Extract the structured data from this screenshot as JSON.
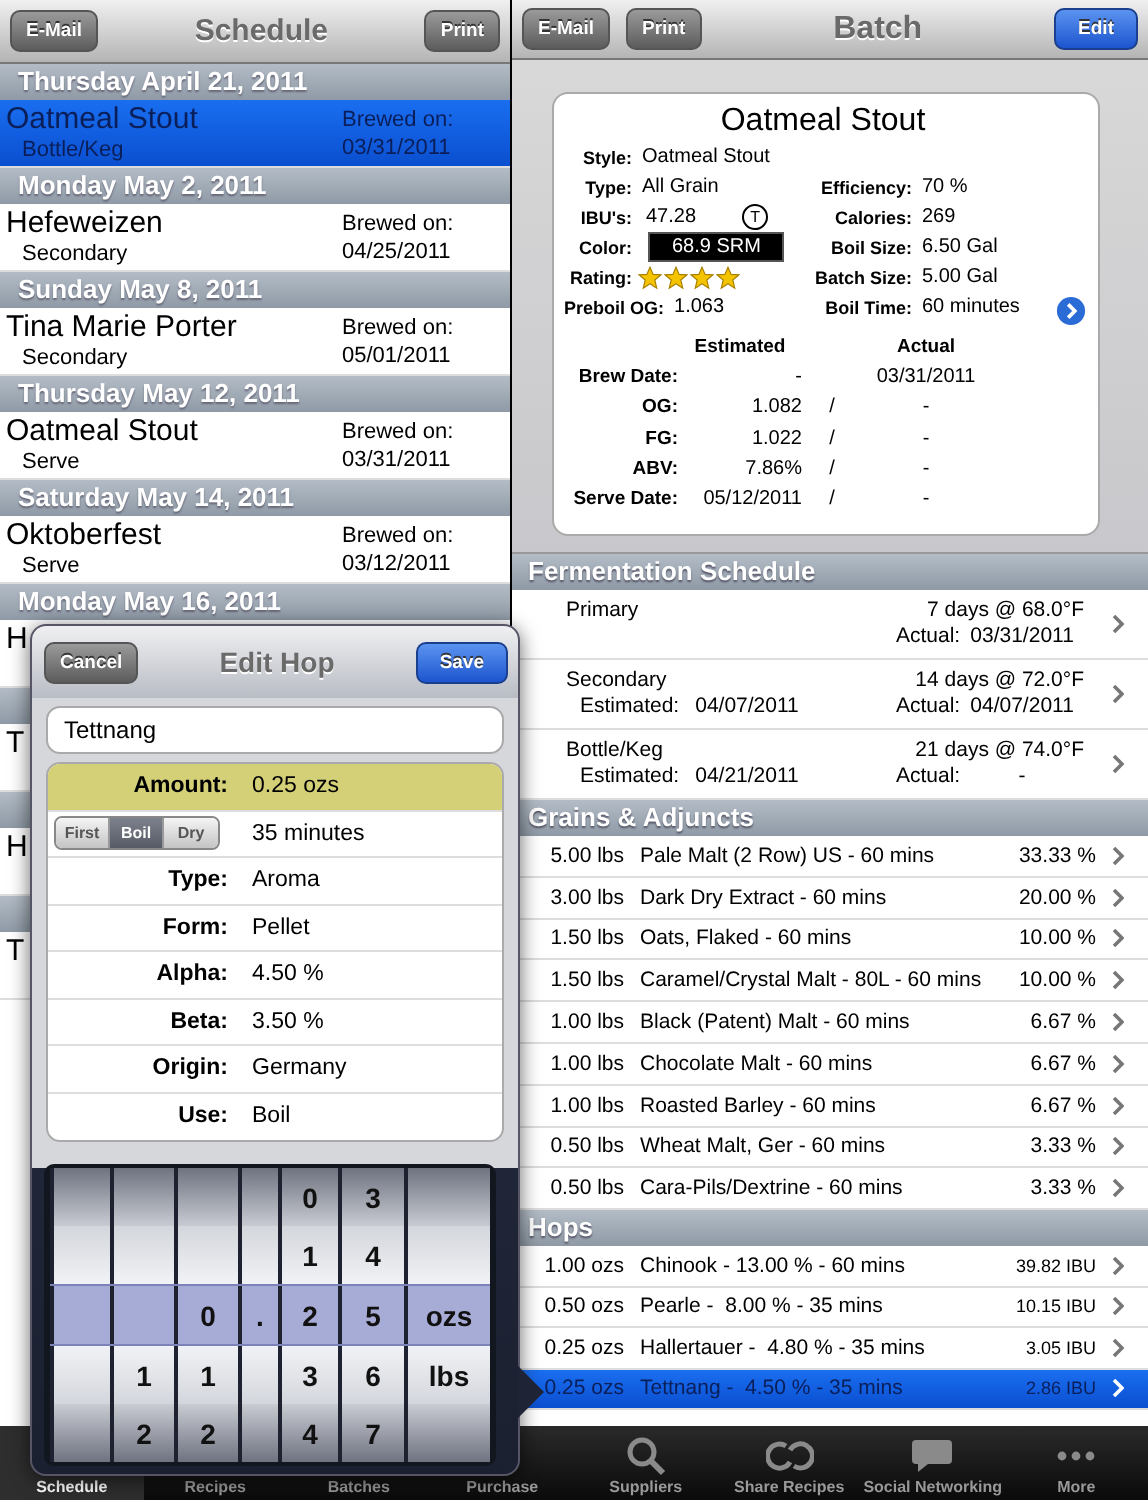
{
  "schedule": {
    "toolbar": {
      "email": "E-Mail",
      "title": "Schedule",
      "print": "Print"
    },
    "entries": [
      {
        "date": "Thursday April 21, 2011",
        "title": "Oatmeal Stout",
        "stage": "Bottle/Keg",
        "brewed_label": "Brewed on:",
        "brewed_date": "03/31/2011",
        "selected": true
      },
      {
        "date": "Monday May 2, 2011",
        "title": "Hefeweizen",
        "stage": "Secondary",
        "brewed_label": "Brewed on:",
        "brewed_date": "04/25/2011",
        "selected": false
      },
      {
        "date": "Sunday May 8, 2011",
        "title": "Tina Marie Porter",
        "stage": "Secondary",
        "brewed_label": "Brewed on:",
        "brewed_date": "05/01/2011",
        "selected": false
      },
      {
        "date": "Thursday May 12, 2011",
        "title": "Oatmeal Stout",
        "stage": "Serve",
        "brewed_label": "Brewed on:",
        "brewed_date": "03/31/2011",
        "selected": false
      },
      {
        "date": "Saturday May 14, 2011",
        "title": "Oktoberfest",
        "stage": "Serve",
        "brewed_label": "Brewed on:",
        "brewed_date": "03/12/2011",
        "selected": false
      },
      {
        "date": "Monday May 16, 2011",
        "title": "H",
        "selected": false
      },
      {
        "title": "T",
        "selected": false
      },
      {
        "title": "H",
        "selected": false
      },
      {
        "title": "T",
        "selected": false
      }
    ]
  },
  "batch": {
    "toolbar": {
      "email": "E-Mail",
      "print": "Print",
      "title": "Batch",
      "edit": "Edit"
    },
    "card": {
      "title": "Oatmeal Stout",
      "rows": [
        {
          "left": {
            "kind": "text",
            "label": "Style:",
            "value": "Oatmeal Stout"
          }
        },
        {
          "left": {
            "kind": "text",
            "label": "Type:",
            "value": "All Grain"
          },
          "right": {
            "label": "Efficiency:",
            "value": "70 %"
          }
        },
        {
          "left": {
            "kind": "ibu",
            "label": "IBU's:",
            "value": "47.28",
            "badge": "T"
          },
          "right": {
            "label": "Calories:",
            "value": "269"
          }
        },
        {
          "left": {
            "kind": "color",
            "label": "Color:",
            "value": "68.9 SRM"
          },
          "right": {
            "label": "Boil Size:",
            "value": "6.50 Gal"
          }
        },
        {
          "left": {
            "kind": "stars",
            "label": "Rating:",
            "stars": 4
          },
          "right": {
            "label": "Batch Size:",
            "value": "5.00 Gal"
          }
        },
        {
          "left": {
            "kind": "text",
            "label": "Preboil OG:",
            "value": "1.063"
          },
          "right": {
            "label": "Boil Time:",
            "value": "60 minutes"
          }
        }
      ],
      "columns": {
        "estimated": "Estimated",
        "actual": "Actual"
      },
      "measures": [
        {
          "label": "Brew Date:",
          "estimated": "-",
          "actual": "03/31/2011"
        },
        {
          "label": "OG:",
          "estimated": "1.082",
          "separator": "/",
          "actual": "-"
        },
        {
          "label": "FG:",
          "estimated": "1.022",
          "separator": "/",
          "actual": "-"
        },
        {
          "label": "ABV:",
          "estimated": "7.86%",
          "separator": "/",
          "actual": "-"
        },
        {
          "label": "Serve Date:",
          "estimated": "05/12/2011",
          "separator": "/",
          "actual": "-"
        }
      ]
    },
    "fermentation": {
      "title": "Fermentation Schedule",
      "rows": [
        {
          "name": "Primary",
          "duration": "7 days @ 68.0°F",
          "actual_label": "Actual:",
          "actual": "03/31/2011"
        },
        {
          "name": "Secondary",
          "estimated_label": "Estimated:",
          "estimated": "04/07/2011",
          "duration": "14 days @ 72.0°F",
          "actual_label": "Actual:",
          "actual": "04/07/2011"
        },
        {
          "name": "Bottle/Keg",
          "estimated_label": "Estimated:",
          "estimated": "04/21/2011",
          "duration": "21 days @ 74.0°F",
          "actual_label": "Actual:",
          "actual": "-"
        }
      ]
    },
    "grains": {
      "title": "Grains & Adjuncts",
      "rows": [
        {
          "amount": "5.00 lbs",
          "name": "Pale Malt (2 Row) US - 60 mins",
          "share": "33.33 %"
        },
        {
          "amount": "3.00 lbs",
          "name": "Dark Dry Extract - 60 mins",
          "share": "20.00 %"
        },
        {
          "amount": "1.50 lbs",
          "name": "Oats, Flaked - 60 mins",
          "share": "10.00 %"
        },
        {
          "amount": "1.50 lbs",
          "name": "Caramel/Crystal Malt - 80L - 60 mins",
          "share": "10.00 %"
        },
        {
          "amount": "1.00 lbs",
          "name": "Black (Patent) Malt - 60 mins",
          "share": "6.67 %"
        },
        {
          "amount": "1.00 lbs",
          "name": "Chocolate Malt - 60 mins",
          "share": "6.67 %"
        },
        {
          "amount": "1.00 lbs",
          "name": "Roasted Barley - 60 mins",
          "share": "6.67 %"
        },
        {
          "amount": "0.50 lbs",
          "name": "Wheat Malt, Ger - 60 mins",
          "share": "3.33 %"
        },
        {
          "amount": "0.50 lbs",
          "name": "Cara-Pils/Dextrine - 60 mins",
          "share": "3.33 %"
        }
      ]
    },
    "hops": {
      "title": "Hops",
      "rows": [
        {
          "amount": "1.00 ozs",
          "name": "Chinook - 13.00 % - 60 mins",
          "ibu": "39.82 IBU",
          "selected": false
        },
        {
          "amount": "0.50 ozs",
          "name": "Pearle -  8.00 % - 35 mins",
          "ibu": "10.15 IBU",
          "selected": false
        },
        {
          "amount": "0.25 ozs",
          "name": "Hallertauer -  4.80 % - 35 mins",
          "ibu": "3.05 IBU",
          "selected": false
        },
        {
          "amount": "0.25 ozs",
          "name": "Tettnang -  4.50 % - 35 mins",
          "ibu": "2.86 IBU",
          "selected": true
        }
      ]
    }
  },
  "edit_hop": {
    "cancel": "Cancel",
    "title": "Edit Hop",
    "save": "Save",
    "name": "Tettnang",
    "rows": [
      {
        "kind": "field",
        "label": "Amount:",
        "value": "0.25 ozs",
        "selected": true
      },
      {
        "kind": "segmented",
        "segments": [
          {
            "label": "First",
            "selected": false
          },
          {
            "label": "Boil",
            "selected": true
          },
          {
            "label": "Dry",
            "selected": false
          }
        ],
        "value": "35 minutes",
        "selected": false
      },
      {
        "kind": "field",
        "label": "Type:",
        "value": "Aroma",
        "selected": false
      },
      {
        "kind": "field",
        "label": "Form:",
        "value": "Pellet",
        "selected": false
      },
      {
        "kind": "field",
        "label": "Alpha:",
        "value": "4.50 %",
        "selected": false
      },
      {
        "kind": "field",
        "label": "Beta:",
        "value": "3.50 %",
        "selected": false
      },
      {
        "kind": "field",
        "label": "Origin:",
        "value": "Germany",
        "selected": false
      },
      {
        "kind": "field",
        "label": "Use:",
        "value": "Boil",
        "selected": false
      }
    ],
    "picker": [
      {
        "cells": [
          null,
          null,
          null,
          null,
          "0",
          "3",
          null
        ],
        "selected": false
      },
      {
        "cells": [
          null,
          null,
          null,
          null,
          "1",
          "4",
          null
        ],
        "selected": false
      },
      {
        "cells": [
          null,
          null,
          "0",
          ".",
          "2",
          "5",
          "ozs"
        ],
        "selected": true
      },
      {
        "cells": [
          null,
          "1",
          "1",
          null,
          "3",
          "6",
          "lbs"
        ],
        "selected": false
      },
      {
        "cells": [
          null,
          "2",
          "2",
          null,
          "4",
          "7",
          null
        ],
        "selected": false
      }
    ]
  },
  "tab_bar": [
    {
      "label": "Schedule",
      "selected": true
    },
    {
      "label": "Recipes",
      "selected": false
    },
    {
      "label": "Batches",
      "selected": false
    },
    {
      "label": "Purchase",
      "selected": false
    },
    {
      "label": "Suppliers",
      "kind": "search",
      "selected": false
    },
    {
      "label": "Share Recipes",
      "kind": "share",
      "selected": false
    },
    {
      "label": "Social Networking",
      "kind": "chat",
      "selected": false
    },
    {
      "label": "More",
      "kind": "more",
      "selected": false
    }
  ]
}
